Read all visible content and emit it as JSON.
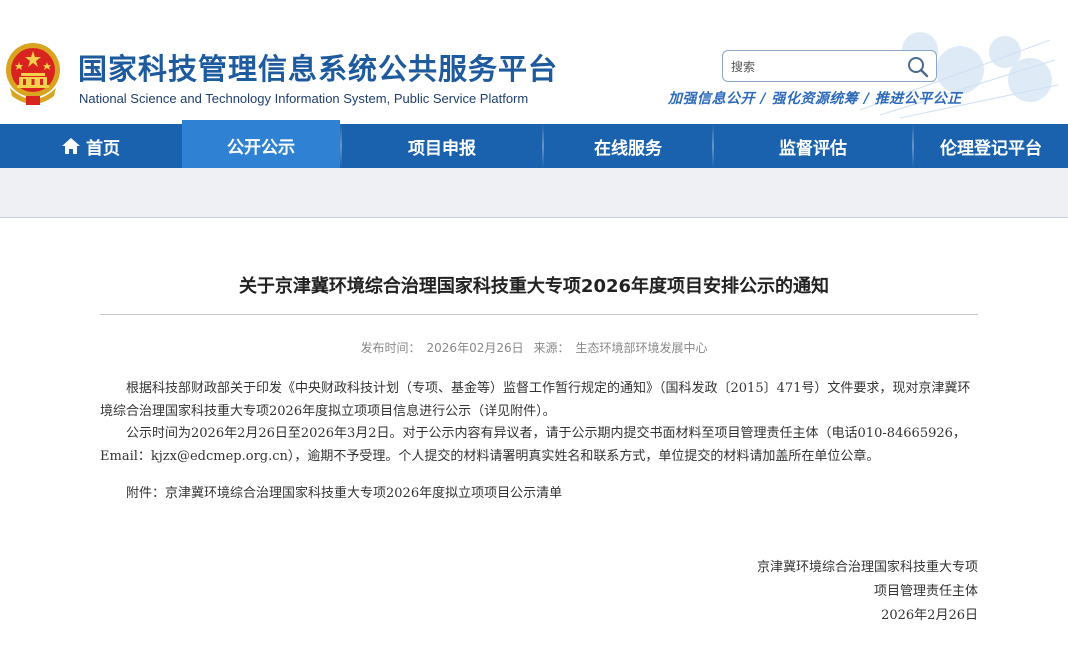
{
  "header": {
    "title": "国家科技管理信息系统公共服务平台",
    "subtitle": "National Science and Technology Information System, Public Service Platform",
    "search_placeholder": "搜索",
    "slogan": "加强信息公开 / 强化资源统筹 / 推进公平公正",
    "emblem_icon": "national-emblem-icon",
    "search_icon": "magnifier-icon",
    "brand_color": "#1d5a9e"
  },
  "nav": {
    "color": "#1a62ad",
    "active_color": "#2f82d3",
    "items": [
      {
        "label": "首页",
        "icon": "home-icon"
      },
      {
        "label": "公开公示"
      },
      {
        "label": "项目申报"
      },
      {
        "label": "在线服务"
      },
      {
        "label": "监督评估"
      },
      {
        "label": "伦理登记平台"
      }
    ]
  },
  "article": {
    "title": "关于京津冀环境综合治理国家科技重大专项2026年度项目安排公示的通知",
    "publish_label": "发布时间：",
    "publish_date": "2026年02月26日",
    "source_label": "来源：",
    "source": "生态环境部环境发展中心",
    "paragraphs": [
      "根据科技部财政部关于印发《中央财政科技计划（专项、基金等）监督工作暂行规定的通知》（国科发政〔2015〕471号）文件要求，现对京津冀环境综合治理国家科技重大专项2026年度拟立项项目信息进行公示（详见附件）。",
      "公示时间为2026年2月26日至2026年3月2日。对于公示内容有异议者，请于公示期内提交书面材料至项目管理责任主体（电话010-84665926，Email：kjzx@edcmep.org.cn），逾期不予受理。个人提交的材料请署明真实姓名和联系方式，单位提交的材料请加盖所在单位公章。"
    ],
    "attachment": "附件：京津冀环境综合治理国家科技重大专项2026年度拟立项项目公示清单",
    "signature": {
      "line1": "京津冀环境综合治理国家科技重大专项",
      "line2": "项目管理责任主体",
      "date": "2026年2月26日"
    }
  }
}
